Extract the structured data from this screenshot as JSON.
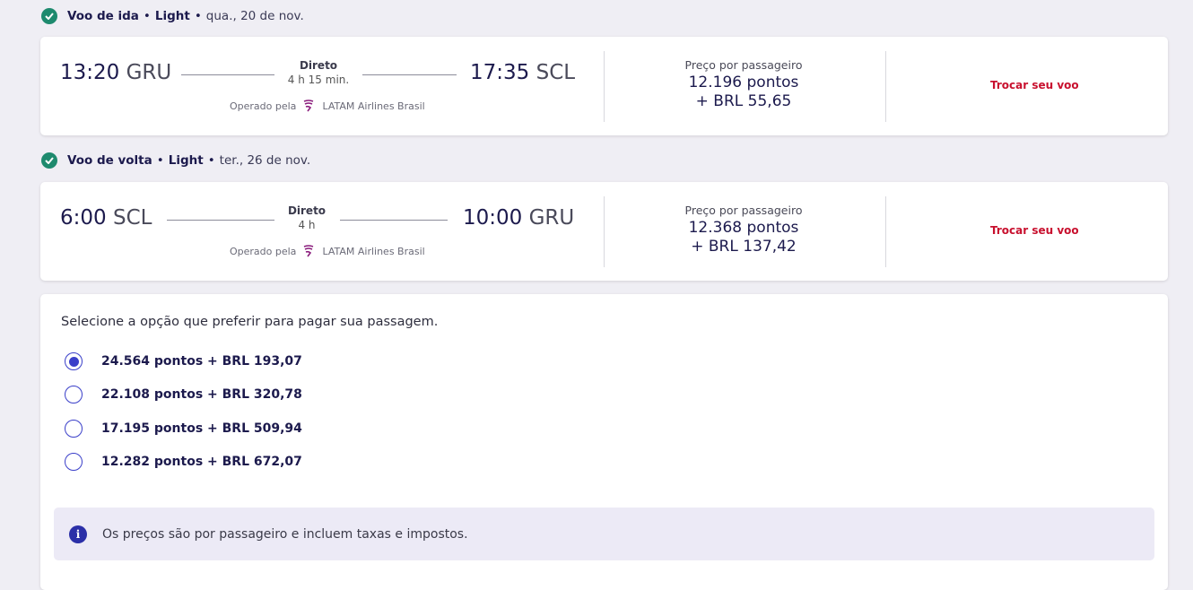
{
  "outbound": {
    "title": "Voo de ida",
    "fare": "Light",
    "date": "qua., 20 de nov.",
    "dep_time": "13:20",
    "dep_code": "GRU",
    "arr_time": "17:35",
    "arr_code": "SCL",
    "stops": "Direto",
    "duration": "4 h 15 min.",
    "operated_label": "Operado pela",
    "airline": "LATAM Airlines Brasil",
    "price_label": "Preço por passageiro",
    "price_points": "12.196 pontos",
    "price_brl": "+ BRL 55,65",
    "change_label": "Trocar seu voo"
  },
  "inbound": {
    "title": "Voo de volta",
    "fare": "Light",
    "date": "ter., 26 de nov.",
    "dep_time": "6:00",
    "dep_code": "SCL",
    "arr_time": "10:00",
    "arr_code": "GRU",
    "stops": "Direto",
    "duration": "4 h",
    "operated_label": "Operado pela",
    "airline": "LATAM Airlines Brasil",
    "price_label": "Preço por passageiro",
    "price_points": "12.368 pontos",
    "price_brl": "+ BRL 137,42",
    "change_label": "Trocar seu voo"
  },
  "payment": {
    "title": "Selecione a opção que preferir para pagar sua passagem.",
    "options": [
      {
        "label": "24.564 pontos + BRL 193,07",
        "selected": true
      },
      {
        "label": "22.108 pontos + BRL 320,78",
        "selected": false
      },
      {
        "label": "17.195 pontos + BRL 509,94",
        "selected": false
      },
      {
        "label": "12.282 pontos + BRL 672,07",
        "selected": false
      }
    ],
    "info": "Os preços são por passageiro e incluem taxas e impostos."
  },
  "colors": {
    "accent": "#3a3fc9",
    "brand_red": "#c8102e",
    "check_green": "#1e8a6e",
    "navy": "#1c1a4d"
  }
}
